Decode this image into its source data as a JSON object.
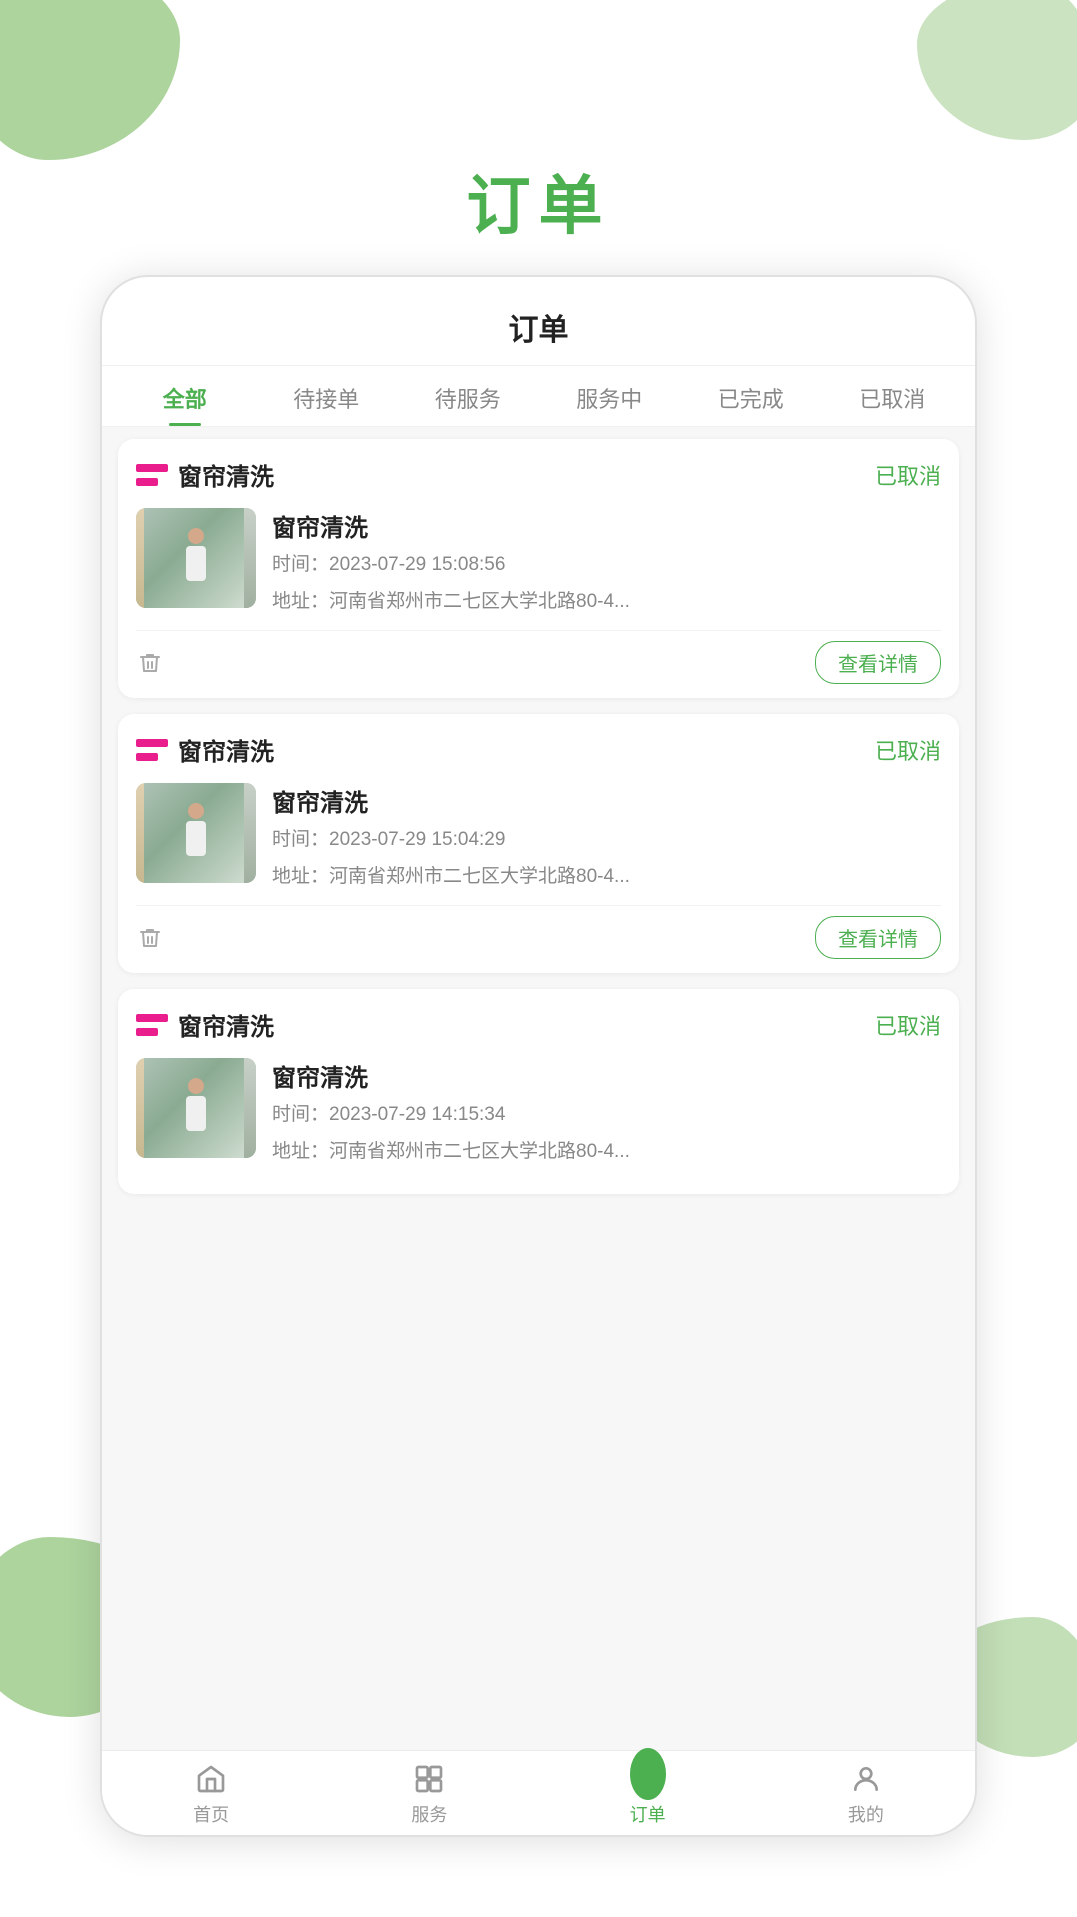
{
  "page": {
    "title": "订单",
    "background_blobs": true
  },
  "app": {
    "header": "订单",
    "tabs": [
      {
        "label": "全部",
        "active": true
      },
      {
        "label": "待接单",
        "active": false
      },
      {
        "label": "待服务",
        "active": false
      },
      {
        "label": "服务中",
        "active": false
      },
      {
        "label": "已完成",
        "active": false
      },
      {
        "label": "已取消",
        "active": false
      }
    ]
  },
  "orders": [
    {
      "id": 1,
      "icon_label": "icon",
      "service_name": "窗帘清洗",
      "status": "已取消",
      "detail_title": "窗帘清洗",
      "time_label": "时间：",
      "time_value": "2023-07-29 15:08:56",
      "address_label": "地址：",
      "address_value": "河南省郑州市二七区大学北路80-4...",
      "detail_btn": "查看详情"
    },
    {
      "id": 2,
      "icon_label": "icon",
      "service_name": "窗帘清洗",
      "status": "已取消",
      "detail_title": "窗帘清洗",
      "time_label": "时间：",
      "time_value": "2023-07-29 15:04:29",
      "address_label": "地址：",
      "address_value": "河南省郑州市二七区大学北路80-4...",
      "detail_btn": "查看详情"
    },
    {
      "id": 3,
      "icon_label": "icon",
      "service_name": "窗帘清洗",
      "status": "已取消",
      "detail_title": "窗帘清洗",
      "time_label": "时间：",
      "time_value": "2023-07-29 14:15:34",
      "address_label": "地址：",
      "address_value": "河南省郑州市二七区大学北路80-4...",
      "detail_btn": "查看详情"
    }
  ],
  "bottom_nav": [
    {
      "label": "首页",
      "icon": "home",
      "active": false
    },
    {
      "label": "服务",
      "icon": "services",
      "active": false
    },
    {
      "label": "订单",
      "icon": "orders",
      "active": true
    },
    {
      "label": "我的",
      "icon": "profile",
      "active": false
    }
  ]
}
